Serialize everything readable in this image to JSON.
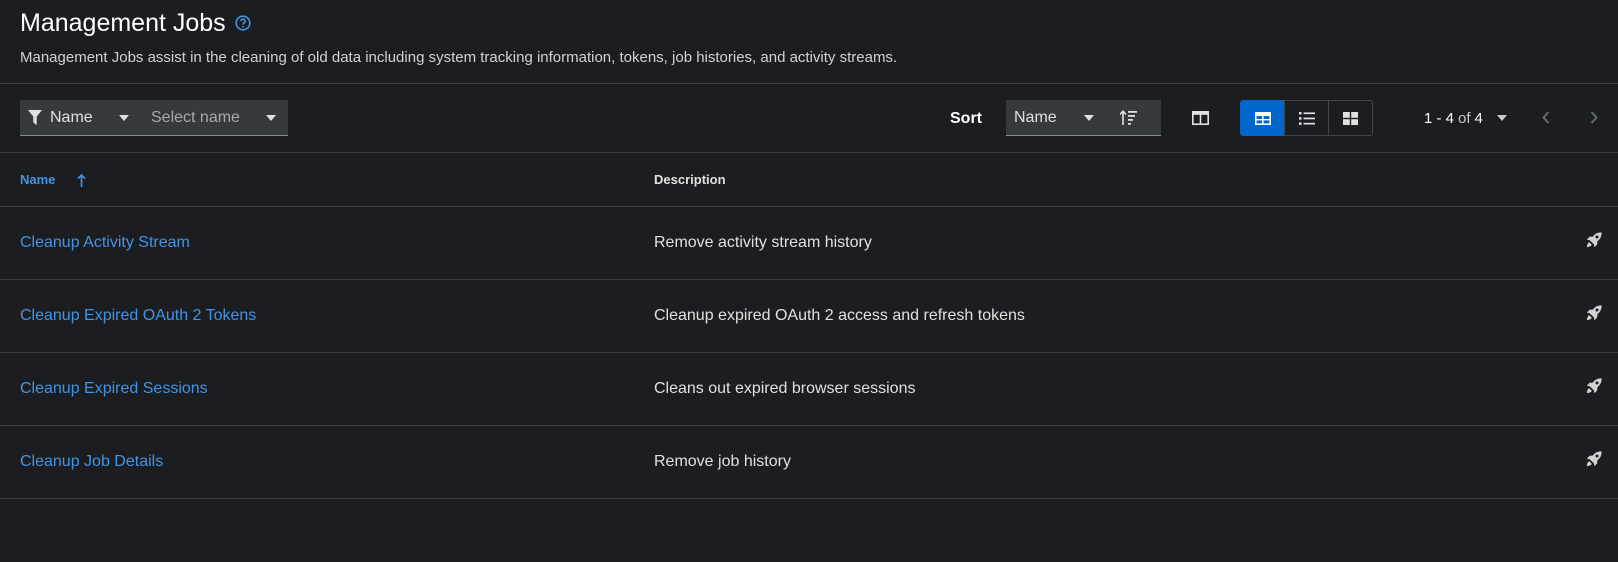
{
  "header": {
    "title": "Management Jobs",
    "description": "Management Jobs assist in the cleaning of old data including system tracking information, tokens, job histories, and activity streams."
  },
  "toolbar": {
    "filter_attribute": "Name",
    "filter_placeholder": "Select name",
    "sort_label": "Sort",
    "sort_field": "Name",
    "pagination": {
      "range": "1 - 4",
      "of": "of",
      "total": "4"
    }
  },
  "table": {
    "columns": {
      "name": "Name",
      "description": "Description"
    },
    "rows": [
      {
        "name": "Cleanup Activity Stream",
        "description": "Remove activity stream history"
      },
      {
        "name": "Cleanup Expired OAuth 2 Tokens",
        "description": "Cleanup expired OAuth 2 access and refresh tokens"
      },
      {
        "name": "Cleanup Expired Sessions",
        "description": "Cleans out expired browser sessions"
      },
      {
        "name": "Cleanup Job Details",
        "description": "Remove job history"
      }
    ]
  },
  "colors": {
    "background": "#1b1d21",
    "link": "#4394e5",
    "active_toggle": "#0066cc",
    "input_bg": "#36393d"
  }
}
